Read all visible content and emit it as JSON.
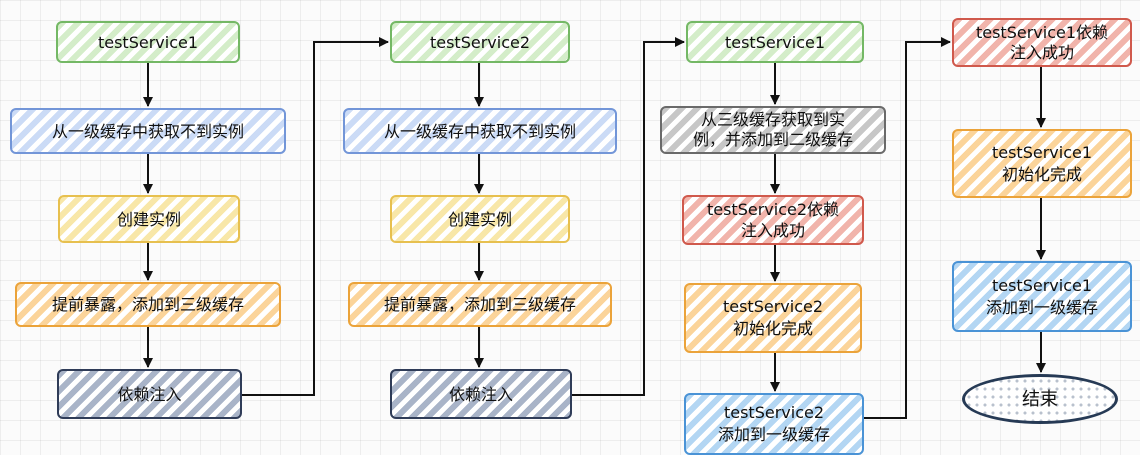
{
  "col1": {
    "node1": "testService1",
    "node2": "从一级缓存中获取不到实例",
    "node3": "创建实例",
    "node4": "提前暴露，添加到三级缓存",
    "node5": "依赖注入"
  },
  "col2": {
    "node1": "testService2",
    "node2": "从一级缓存中获取不到实例",
    "node3": "创建实例",
    "node4": "提前暴露，添加到三级缓存",
    "node5": "依赖注入"
  },
  "col3": {
    "node1": "testService1",
    "node2_line1": "从三级缓存获取到实",
    "node2_line2": "例，并添加到二级缓存",
    "node3_line1": "testService2依赖",
    "node3_line2": "注入成功",
    "node4_line1": "testService2",
    "node4_line2": "初始化完成",
    "node5_line1": "testService2",
    "node5_line2": "添加到一级缓存"
  },
  "col4": {
    "node1_line1": "testService1依赖",
    "node1_line2": "注入成功",
    "node2_line1": "testService1",
    "node2_line2": "初始化完成",
    "node3_line1": "testService1",
    "node3_line2": "添加到一级缓存",
    "end": "结束"
  }
}
